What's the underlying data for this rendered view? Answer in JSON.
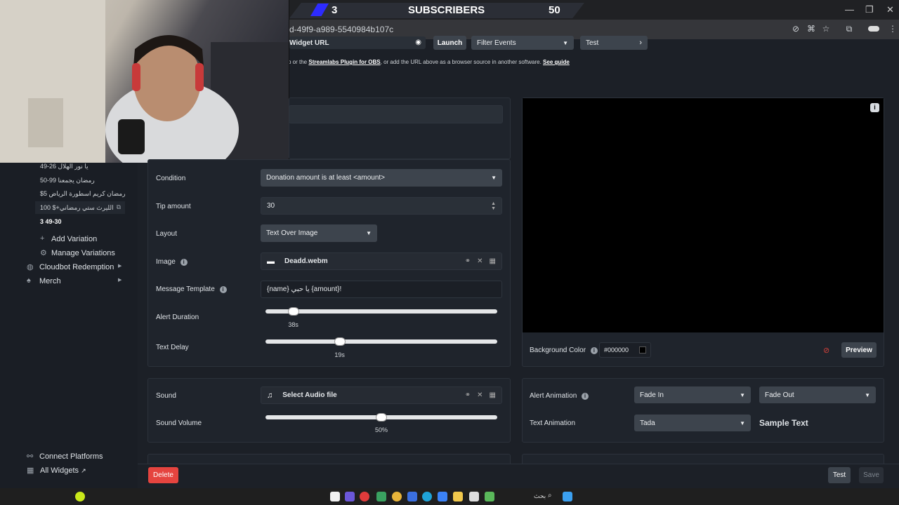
{
  "overlay": {
    "sub_count": "3",
    "sub_label": "SUBSCRIBERS",
    "sub_goal": "50"
  },
  "browser": {
    "url_fragment": "d-49f9-a989-5540984b107c"
  },
  "widget_bar": {
    "widget_url_label": "Widget URL",
    "launch": "Launch",
    "filter_events": "Filter Events",
    "test": "Test",
    "hint_pre": "p or the",
    "hint_link": "Streamlabs Plugin for OBS",
    "hint_post": ", or add the URL above as a browser source in another software.",
    "see_guide": "See guide"
  },
  "sidebar": {
    "variations": [
      {
        "label": "يا نور الهلال 26-49"
      },
      {
        "label": "رمضان يجمعنا 99-50"
      },
      {
        "label": "$رمضان كريم اسطورة الرياض 5"
      },
      {
        "label": "100 $+الليرث ستي رمضاني"
      },
      {
        "label": "3 49-30"
      }
    ],
    "add_variation": "Add Variation",
    "manage_variations": "Manage Variations",
    "cloudbot": "Cloudbot Redemption",
    "merch": "Merch",
    "connect_platforms": "Connect Platforms",
    "all_widgets": "All Widgets"
  },
  "form": {
    "condition_label": "Condition",
    "condition_value": "Donation amount is at least <amount>",
    "tip_label": "Tip amount",
    "tip_value": "30",
    "layout_label": "Layout",
    "layout_value": "Text Over Image",
    "image_label": "Image",
    "image_value": "Deadd.webm",
    "template_label": "Message Template",
    "template_value": "{name} يا حبي {amount}!",
    "duration_label": "Alert Duration",
    "duration_value": "38s",
    "duration_fraction": 0.12,
    "delay_label": "Text Delay",
    "delay_value": "19s",
    "delay_fraction": 0.32
  },
  "preview": {
    "bg_color_label": "Background Color",
    "bg_color_value": "#000000",
    "preview_btn": "Preview"
  },
  "sound": {
    "sound_label": "Sound",
    "sound_value": "Select Audio file",
    "volume_label": "Sound Volume",
    "volume_value": "50%",
    "volume_fraction": 0.5
  },
  "animation": {
    "alert_anim_label": "Alert Animation",
    "fade_in": "Fade In",
    "fade_out": "Fade Out",
    "text_anim_label": "Text Animation",
    "text_anim_value": "Tada",
    "sample_text": "Sample Text"
  },
  "footer": {
    "delete": "Delete",
    "test": "Test",
    "save": "Save"
  },
  "taskbar": {
    "search": "بحث"
  },
  "colors": {
    "delete": "#e5443f",
    "accent_blue": "#2d2bff"
  }
}
